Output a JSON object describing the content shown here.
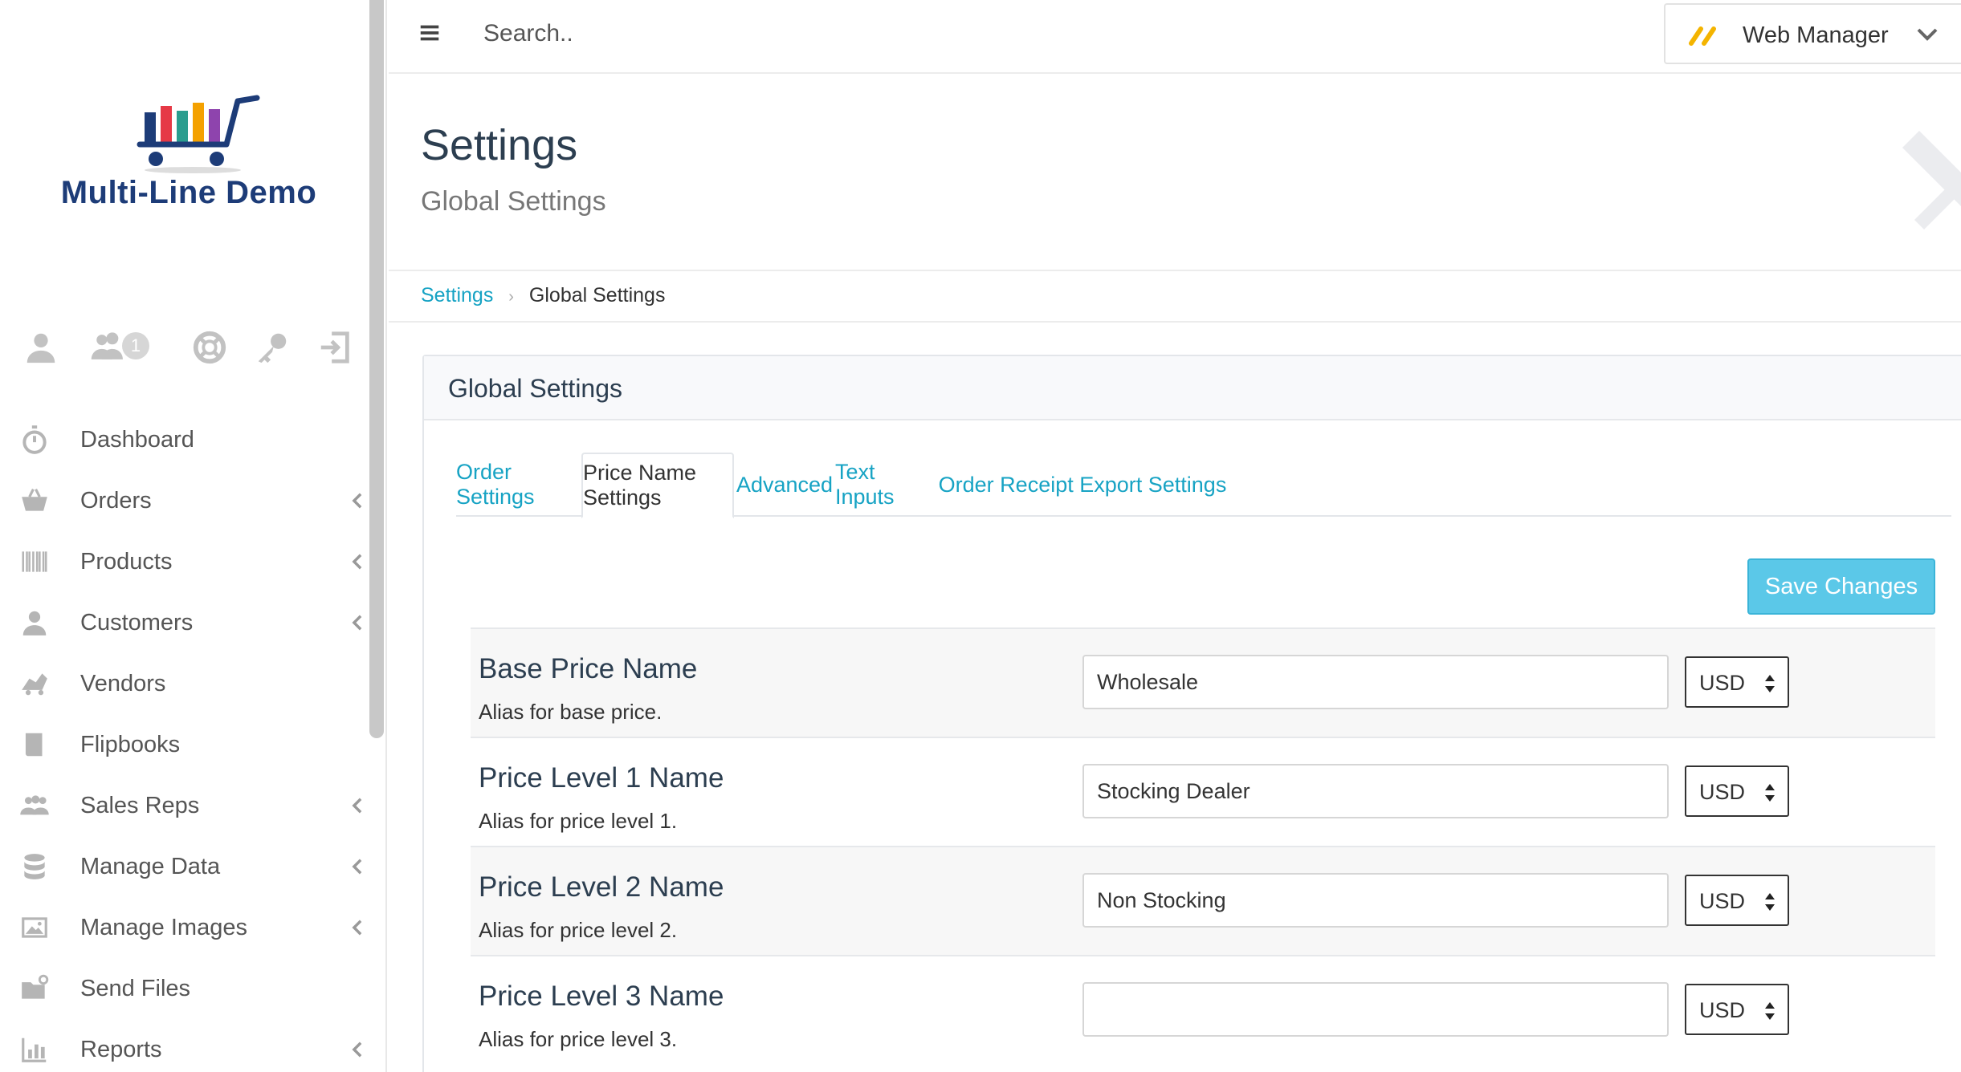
{
  "brand": {
    "name": "Multi-Line Demo"
  },
  "quick_icons": [
    {
      "icon": "user-icon"
    },
    {
      "icon": "users-icon",
      "badge": "1"
    },
    {
      "icon": "lifebuoy-icon"
    },
    {
      "icon": "key-icon"
    },
    {
      "icon": "sign-out-icon"
    }
  ],
  "nav": {
    "items": [
      {
        "label": "Dashboard",
        "icon": "stopwatch-icon",
        "has_sub": false
      },
      {
        "label": "Orders",
        "icon": "basket-icon",
        "has_sub": true
      },
      {
        "label": "Products",
        "icon": "barcode-icon",
        "has_sub": true
      },
      {
        "label": "Customers",
        "icon": "user-icon",
        "has_sub": true
      },
      {
        "label": "Vendors",
        "icon": "truck-icon",
        "has_sub": false
      },
      {
        "label": "Flipbooks",
        "icon": "book-icon",
        "has_sub": false
      },
      {
        "label": "Sales Reps",
        "icon": "users-icon",
        "has_sub": true
      },
      {
        "label": "Manage Data",
        "icon": "database-icon",
        "has_sub": true
      },
      {
        "label": "Manage Images",
        "icon": "image-icon",
        "has_sub": true
      },
      {
        "label": "Send Files",
        "icon": "folder-upload-icon",
        "has_sub": false
      },
      {
        "label": "Reports",
        "icon": "bar-chart-icon",
        "has_sub": true
      }
    ]
  },
  "topbar": {
    "search_placeholder": "Search..",
    "user_name": "Web Manager"
  },
  "page": {
    "title": "Settings",
    "subtitle": "Global Settings"
  },
  "breadcrumb": {
    "parent": "Settings",
    "current": "Global Settings"
  },
  "panel": {
    "title": "Global Settings",
    "tabs": [
      {
        "label": "Order Settings",
        "active": false
      },
      {
        "label": "Price Name Settings",
        "active": true
      },
      {
        "label": "Advanced",
        "active": false
      },
      {
        "label": "Text Inputs",
        "active": false
      },
      {
        "label": "Order Receipt Export Settings",
        "active": false
      }
    ],
    "save_label": "Save Changes",
    "rows": [
      {
        "title": "Base Price Name",
        "help": "Alias for base price.",
        "value": "Wholesale",
        "currency": "USD"
      },
      {
        "title": "Price Level 1 Name",
        "help": "Alias for price level 1.",
        "value": "Stocking Dealer",
        "currency": "USD"
      },
      {
        "title": "Price Level 2 Name",
        "help": "Alias for price level 2.",
        "value": "Non Stocking",
        "currency": "USD"
      },
      {
        "title": "Price Level 3 Name",
        "help": "Alias for price level 3.",
        "value": "",
        "currency": "USD"
      }
    ]
  },
  "colors": {
    "accent": "#17a3c4",
    "save_button": "#5bc8e8",
    "brand_text": "#1d3c78"
  }
}
